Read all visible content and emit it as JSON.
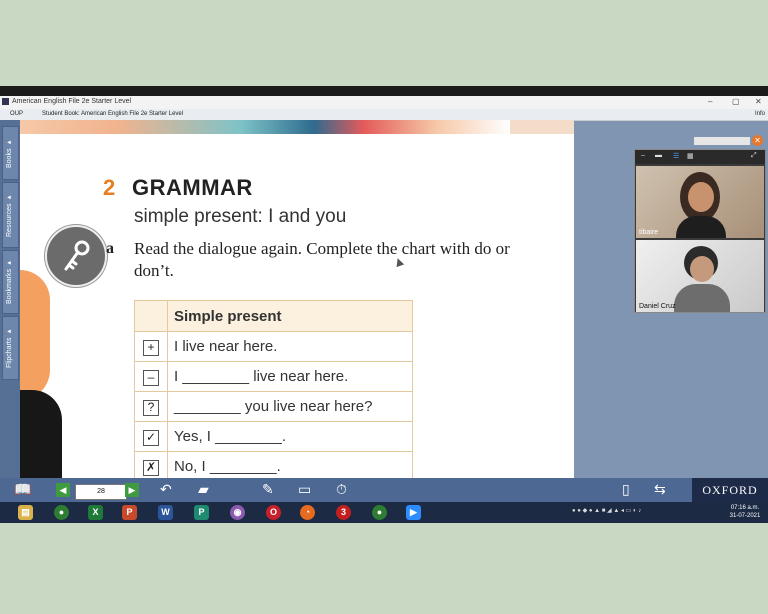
{
  "window": {
    "title": "American English File 2e Starter Level",
    "min": "–",
    "max": "▢",
    "close": "✕"
  },
  "menubar": {
    "oup": "OUP",
    "book": "Student Book: American English File 2e Starter Level",
    "info": "Info"
  },
  "sidetabs": [
    "Books ▸",
    "Resources ▸",
    "Bookmarks ▸",
    "Flipcharts ▸"
  ],
  "section": {
    "number": "2",
    "title": "GRAMMAR",
    "subtitle": "simple present: I and you",
    "item_letter": "a",
    "instruction": "Read the dialogue again. Complete the chart with do or don’t."
  },
  "table": {
    "header": "Simple present",
    "rows": [
      {
        "symbol": "+",
        "text": "I live near here."
      },
      {
        "symbol": "–",
        "text": "I ________ live near here."
      },
      {
        "symbol": "?",
        "text": "________ you live near here?"
      },
      {
        "symbol": "✓",
        "text": "Yes, I ________."
      },
      {
        "symbol": "✗",
        "text": "No, I ________."
      }
    ]
  },
  "video": {
    "participants": [
      {
        "name": "tibaire"
      },
      {
        "name": "Daniel Cruz"
      }
    ]
  },
  "toolbar": {
    "page_number": "28",
    "brand": "OXFORD"
  },
  "clock": {
    "time": "07:16 a.m.",
    "date": "31-07-2021"
  },
  "colors": {
    "accent_orange": "#e67e22",
    "toolbar_blue": "#4d6892",
    "table_header": "#fbf1de"
  }
}
